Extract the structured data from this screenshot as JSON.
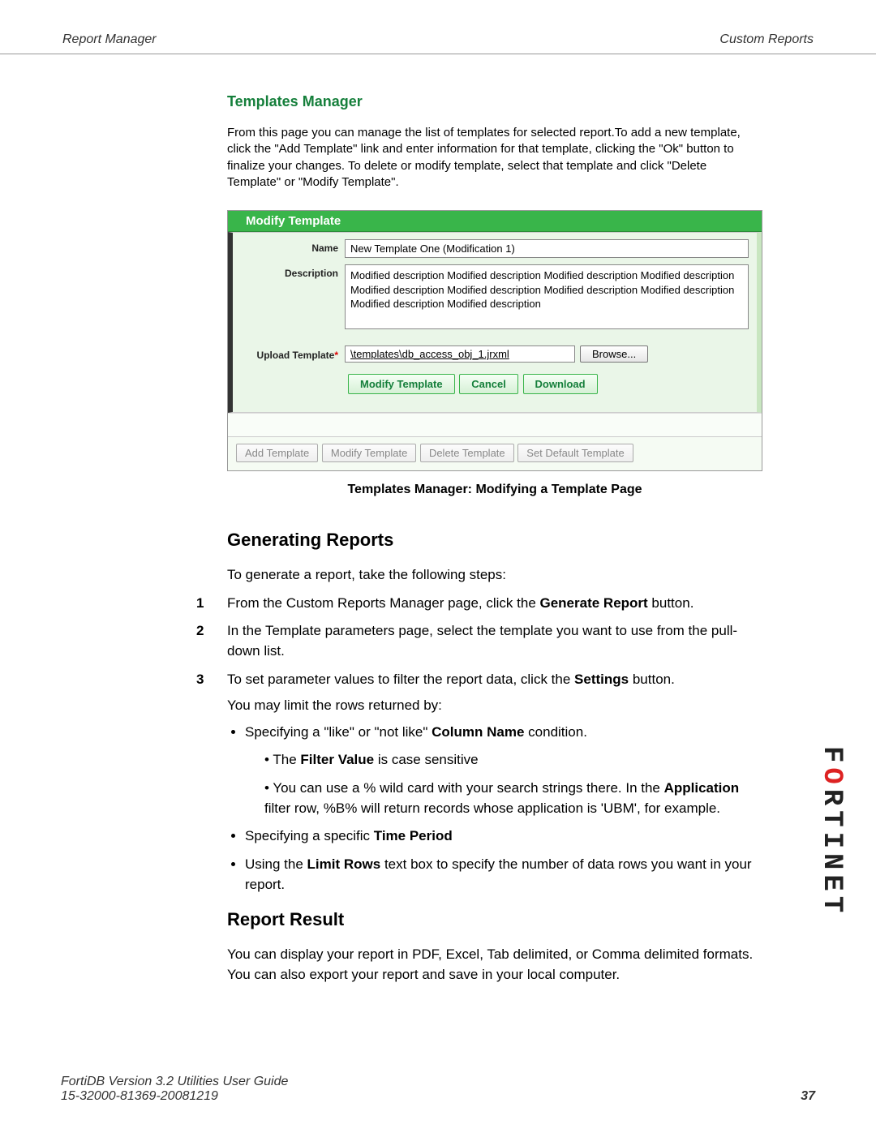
{
  "header": {
    "left": "Report Manager",
    "right": "Custom Reports"
  },
  "tm": {
    "title": "Templates Manager",
    "desc": "From this page you can manage the list of templates for selected report.To add a new template, click the \"Add Template\" link and enter information for that template, clicking the \"Ok\" button to finalize your changes. To delete or modify template, select that template and click \"Delete Template\" or \"Modify Template\"."
  },
  "panel": {
    "title": "Modify Template",
    "labels": {
      "name": "Name",
      "description": "Description",
      "upload": "Upload Template"
    },
    "values": {
      "name": "New Template One (Modification 1)",
      "description": "Modified description Modified description Modified description Modified description Modified description Modified description Modified description Modified description Modified description Modified description",
      "path": "\\templates\\db_access_obj_1.jrxml"
    },
    "buttons": {
      "browse": "Browse...",
      "modify": "Modify Template",
      "cancel": "Cancel",
      "download": "Download"
    },
    "footer": {
      "add": "Add Template",
      "modify": "Modify Template",
      "delete": "Delete Template",
      "setdefault": "Set Default Template"
    }
  },
  "caption": "Templates Manager: Modifying a Template Page",
  "gen": {
    "heading": "Generating Reports",
    "intro": "To generate a report, take the following steps:",
    "step1a": "From the Custom Reports Manager page, click the ",
    "step1b": "Generate Report",
    "step1c": " button.",
    "step2": "In the Template parameters page, select the template you want to use from the pull-down list.",
    "step3a": "To set parameter values to filter the report data, click the ",
    "step3b": "Settings",
    "step3c": " button.",
    "step3d": "You may limit the rows returned by:",
    "b1a": "Specifying a \"like\" or \"not like\" ",
    "b1b": "Column Name",
    "b1c": " condition.",
    "sb1a": "The ",
    "sb1b": "Filter Value",
    "sb1c": " is case sensitive",
    "sb2a": "You can use a % wild card with your search strings there. In the ",
    "sb2b": "Application",
    "sb2c": " filter row, %B% will return records whose application is 'UBM', for example.",
    "b2a": "Specifying a specific ",
    "b2b": "Time Period",
    "b3a": "Using the ",
    "b3b": "Limit Rows",
    "b3c": " text box to specify the number of data rows you want in your report."
  },
  "result": {
    "heading": "Report Result",
    "text": "You can display your report in PDF, Excel, Tab delimited, or Comma delimited formats. You can also export your report and save in your local computer."
  },
  "footer": {
    "line1": "FortiDB Version 3.2 Utilities  User Guide",
    "line2": "15-32000-81369-20081219",
    "page": "37"
  },
  "logo": {
    "a": "F",
    "b": "O",
    "c": "RTINET"
  }
}
